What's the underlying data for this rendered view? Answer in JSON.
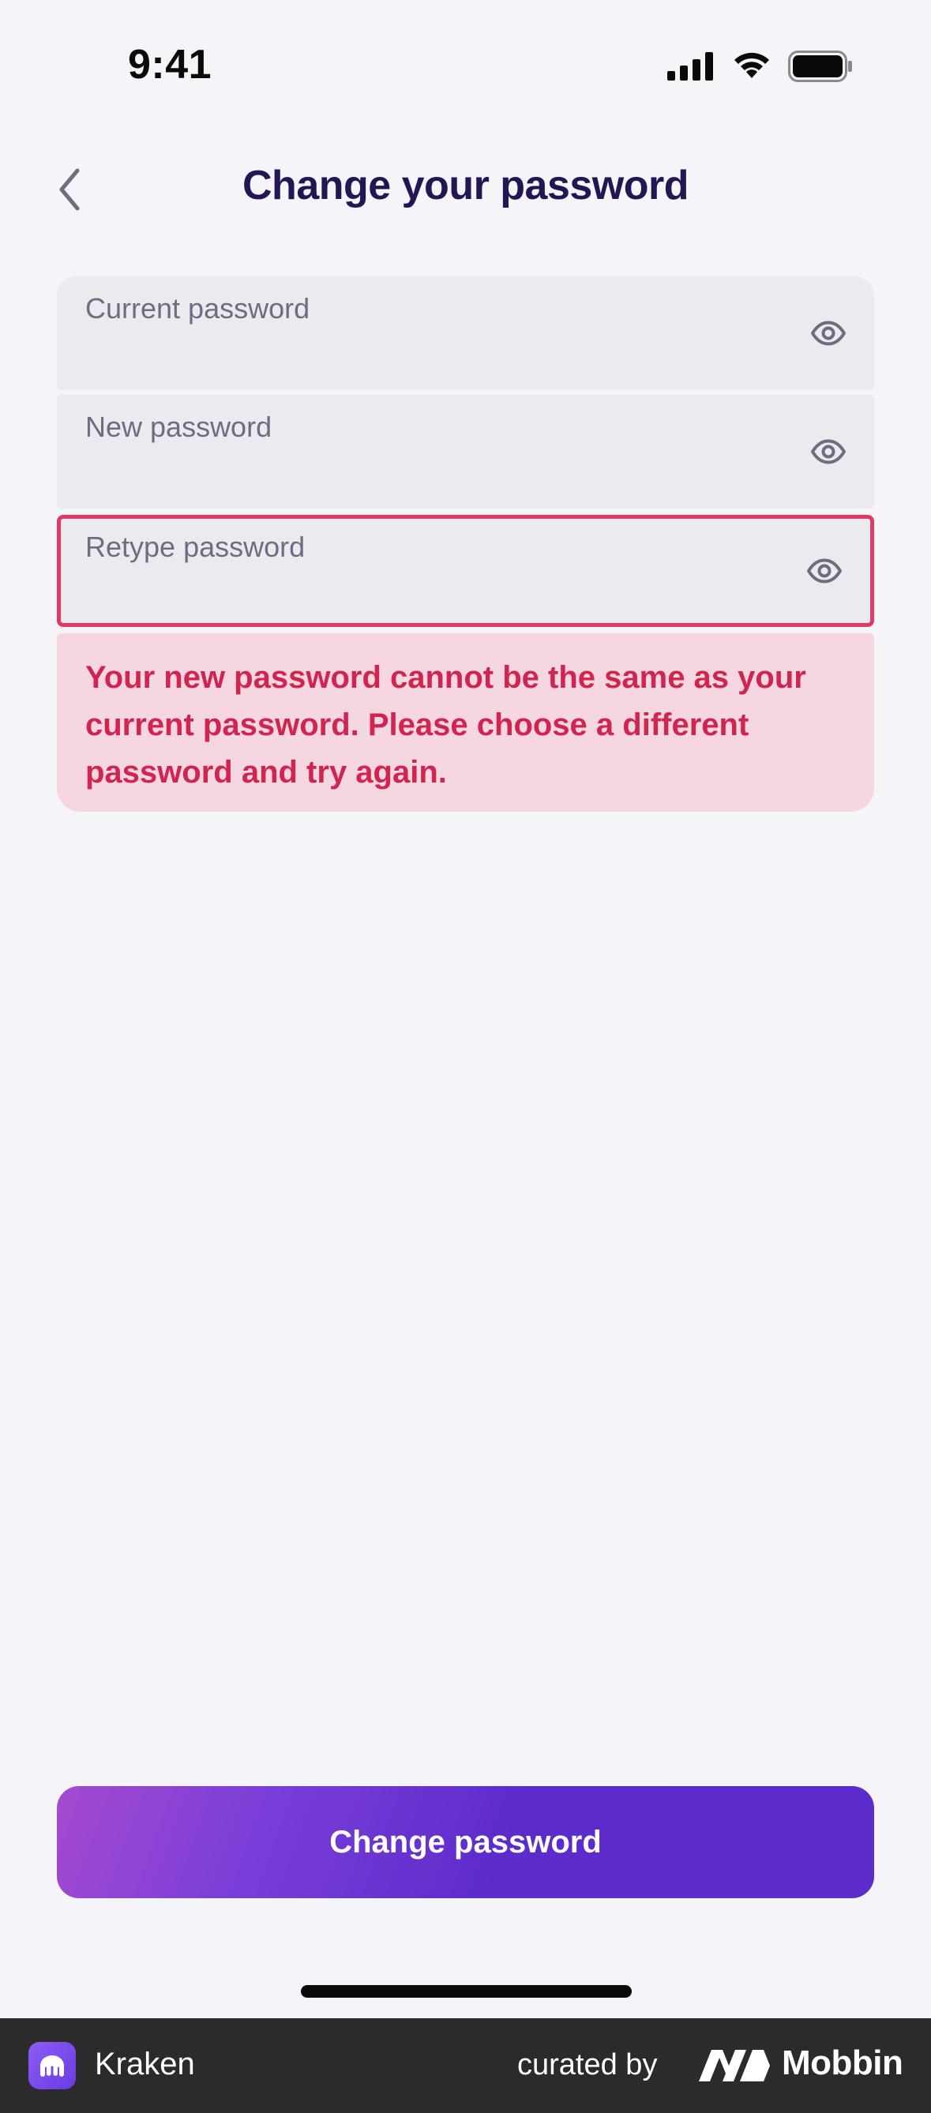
{
  "status_bar": {
    "time": "9:41"
  },
  "header": {
    "title": "Change your password",
    "back_icon": "chevron-left-icon"
  },
  "form": {
    "current_password": {
      "label": "Current password",
      "value": "",
      "icon": "eye-icon"
    },
    "new_password": {
      "label": "New password",
      "value": "",
      "icon": "eye-icon"
    },
    "retype_password": {
      "label": "Retype password",
      "value": "",
      "icon": "eye-icon",
      "state": "error"
    }
  },
  "error": {
    "message": "Your new password cannot be the same as your current password. Please choose a different password and try again."
  },
  "actions": {
    "submit_label": "Change password"
  },
  "footer": {
    "app_name": "Kraken",
    "curated_by": "curated by",
    "brand": "Mobbin"
  },
  "colors": {
    "background": "#F5F4F9",
    "title": "#241553",
    "field_bg": "#EBEAEF",
    "error_border": "#E03A65",
    "error_bg": "#F6D6E0",
    "error_text": "#CF2550",
    "button_start": "#A44AD0",
    "button_end": "#5C2BCB"
  }
}
